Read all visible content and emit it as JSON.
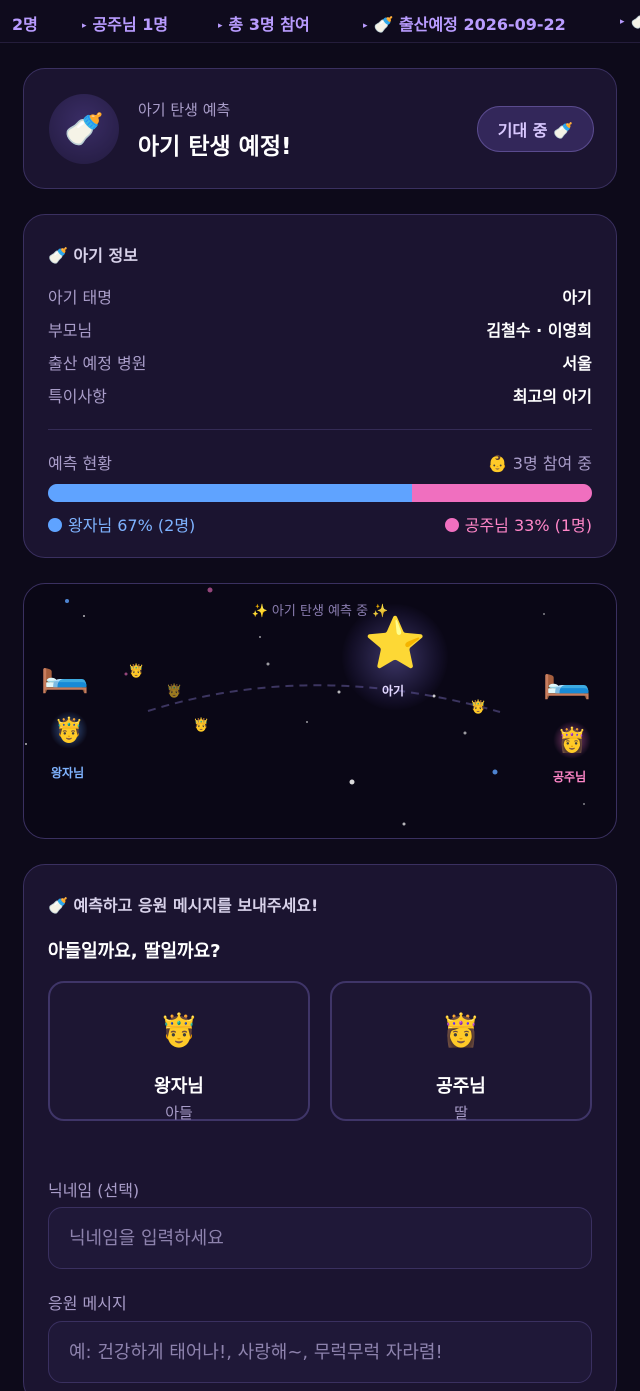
{
  "ticker": [
    {
      "text": "2명",
      "arrow": ""
    },
    {
      "text": "공주님 1명",
      "arrow": "▸"
    },
    {
      "text": "총 3명 참여",
      "arrow": "▸"
    },
    {
      "text": "🍼 출산예정 2026-09-22",
      "arrow": "▸"
    },
    {
      "text": "🍼",
      "arrow": "▸"
    }
  ],
  "hero": {
    "icon": "🍼",
    "subtitle": "아기 탄생 예측",
    "title": "아기 탄생 예정!",
    "status_pill": "기대 중 🍼"
  },
  "info": {
    "heading": "🍼 아기 정보",
    "rows": [
      {
        "key": "아기 태명",
        "value": "아기"
      },
      {
        "key": "부모님",
        "value": "김철수 · 이영희"
      },
      {
        "key": "출산 예정 병원",
        "value": "서울"
      },
      {
        "key": "특이사항",
        "value": "최고의 아기"
      }
    ],
    "status_label": "예측 현황",
    "participant_count": "👶 3명 참여 중",
    "boy_fraction": 0.67,
    "girl_fraction": 0.33,
    "boy_legend": "왕자님 67% (2명)",
    "girl_legend": "공주님 33% (1명)",
    "colors": {
      "boy": "#5fa3ff",
      "girl": "#f06fbf"
    }
  },
  "scene": {
    "caption": "✨ 아기 탄생 예측 중 ✨",
    "bed_icon": "🛏️",
    "prince_icon": "🤴",
    "princess_icon": "👸",
    "prince_label": "왕자님",
    "princess_label": "공주님",
    "star_icon": "⭐",
    "baby_label": "아기"
  },
  "form": {
    "heading": "🍼 예측하고 응원 메시지를 보내주세요!",
    "question": "아들일까요, 딸일까요?",
    "choices": [
      {
        "icon": "🤴",
        "name": "왕자님",
        "sub": "아들"
      },
      {
        "icon": "👸",
        "name": "공주님",
        "sub": "딸"
      }
    ],
    "nickname_label": "닉네임 (선택)",
    "nickname_placeholder": "닉네임을 입력하세요",
    "message_label": "응원 메시지",
    "message_placeholder": "예: 건강하게 태어나!, 사랑해~, 무럭무럭 자라렴!"
  }
}
